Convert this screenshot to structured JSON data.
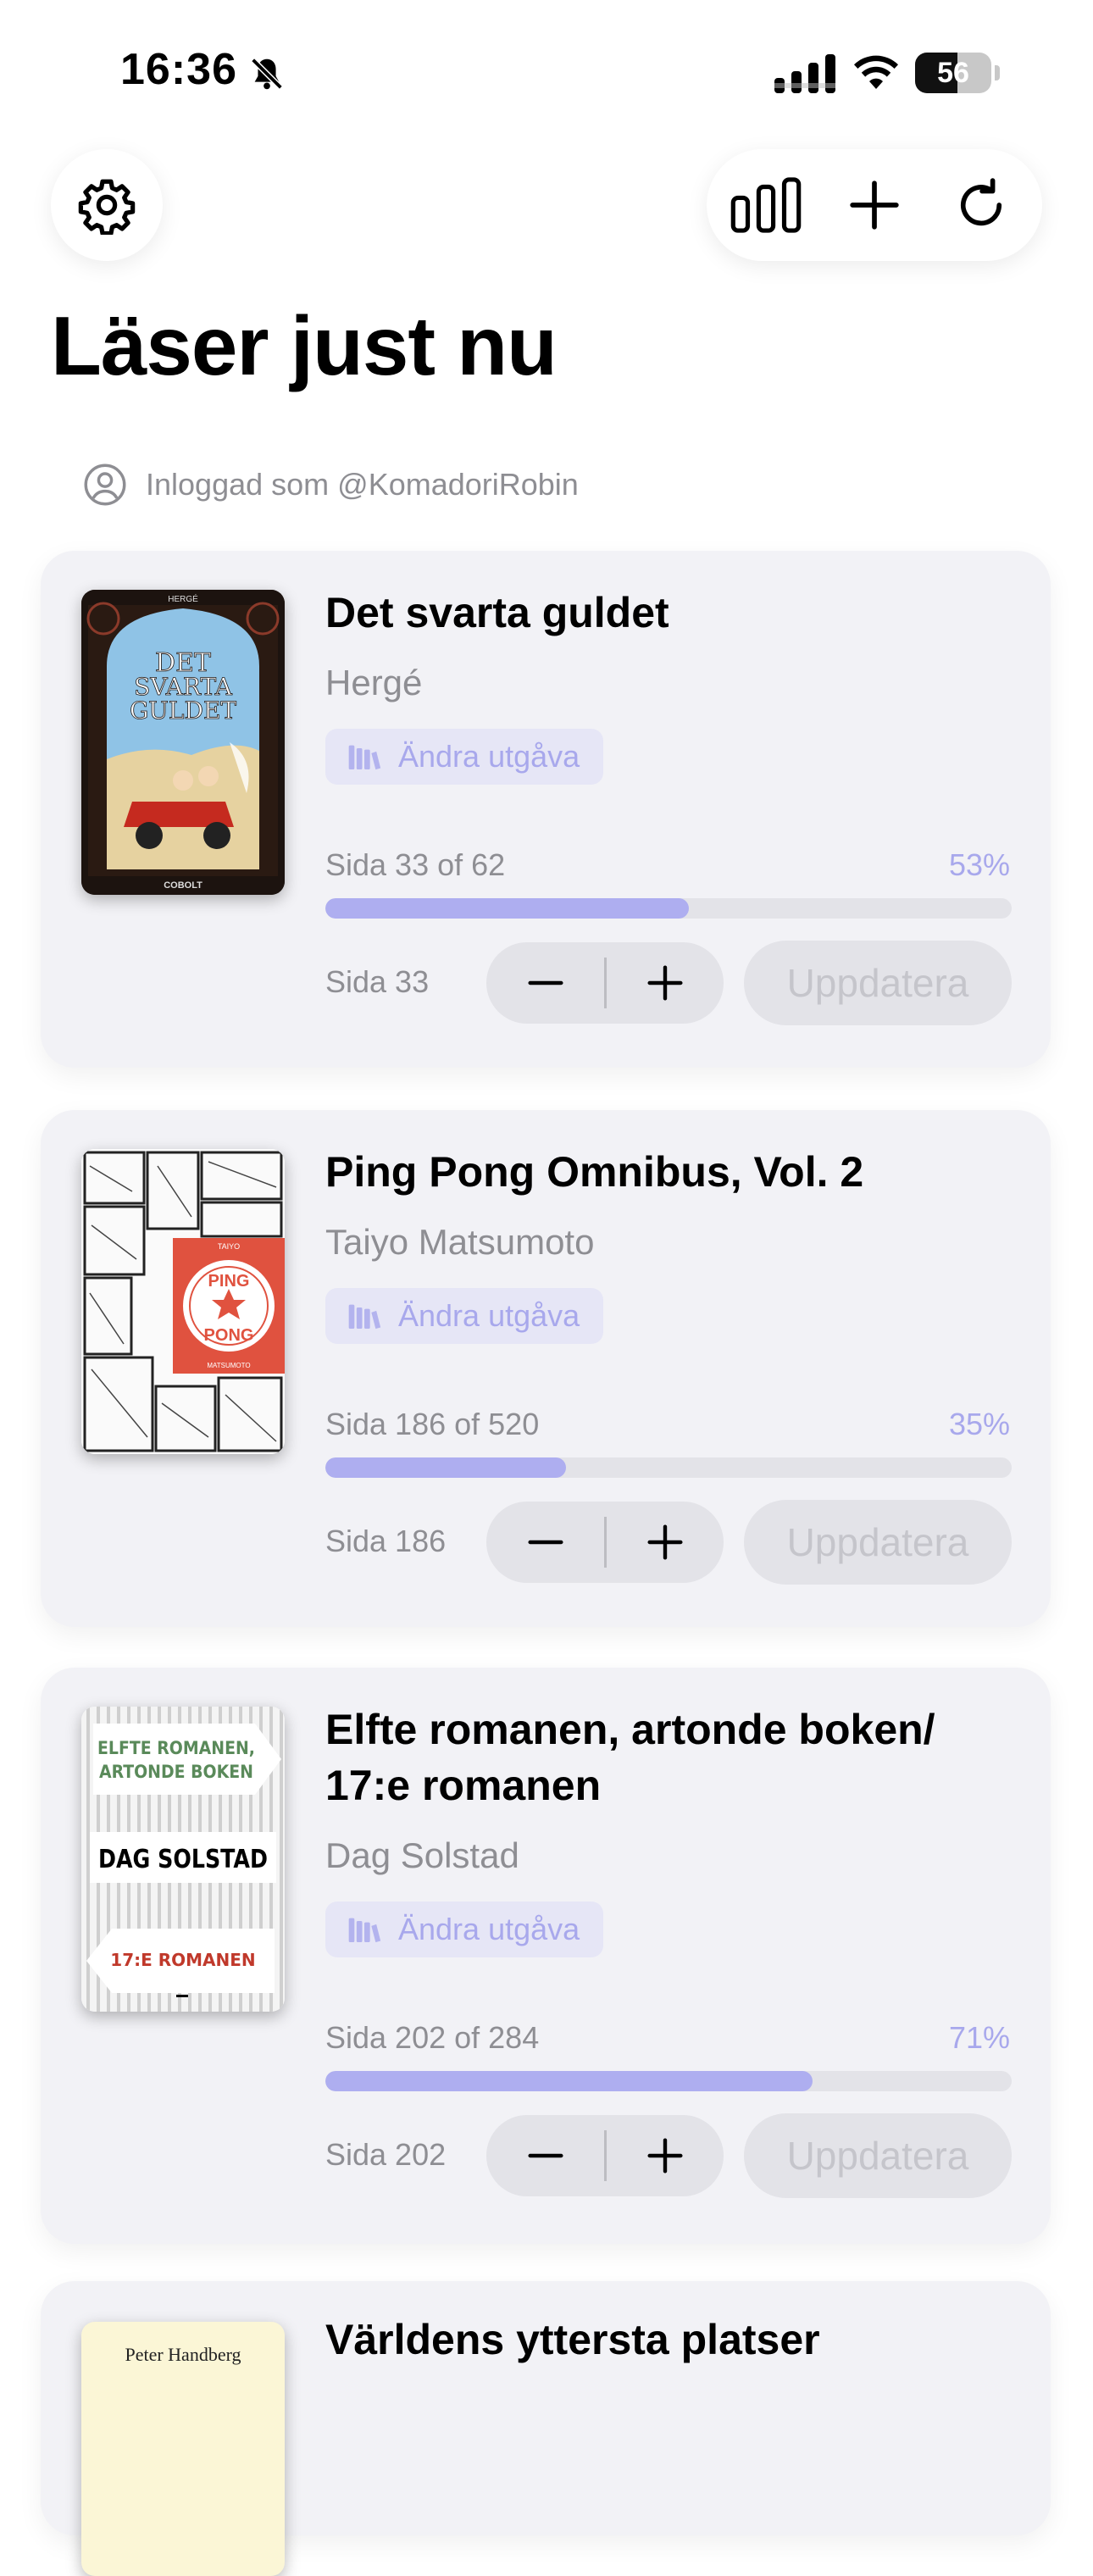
{
  "status_bar": {
    "time": "16:36",
    "battery": "56",
    "battery_level": 0.56
  },
  "header": {
    "title": "Läser just nu"
  },
  "account": {
    "text": "Inloggad som @KomadoriRobin"
  },
  "icons": {
    "settings": "gear-icon",
    "stats": "bar-chart-icon",
    "add": "plus-icon",
    "refresh": "refresh-icon",
    "mute": "bell-slash-icon",
    "profile": "person-circle-icon",
    "edition": "books-icon"
  },
  "colors": {
    "accent": "#aeaef0",
    "accent_text": "#a8a8ec",
    "card_bg": "#f2f2f6"
  },
  "books": [
    {
      "title": "Det svarta guldet",
      "author": "Hergé",
      "edition_label": "Ändra utgåva",
      "progress_label": "Sida 33 of 62",
      "percent_label": "53%",
      "progress": 0.53,
      "page_label": "Sida 33",
      "update_label": "Uppdatera",
      "cover": {
        "top_text": "HERGÉ",
        "title": "DET SVARTA GULDET",
        "bottom_text": "COBOLT"
      }
    },
    {
      "title": "Ping Pong Omnibus, Vol. 2",
      "author": "Taiyo Matsumoto",
      "edition_label": "Ändra utgåva",
      "progress_label": "Sida 186 of 520",
      "percent_label": "35%",
      "progress": 0.35,
      "page_label": "Sida 186",
      "update_label": "Uppdatera",
      "cover": {
        "top_text": "TAIYO",
        "title_1": "PING",
        "title_2": "PONG",
        "bottom_text": "MATSUMOTO"
      }
    },
    {
      "title": "Elfte romanen, artonde boken/ 17:e romanen",
      "author": "Dag Solstad",
      "edition_label": "Ändra utgåva",
      "progress_label": "Sida 202 of 284",
      "percent_label": "71%",
      "progress": 0.71,
      "page_label": "Sida 202",
      "update_label": "Uppdatera",
      "cover": {
        "line1": "ELFTE ROMANEN,",
        "line2": "ARTONDE BOKEN",
        "author": "DAG SOLSTAD",
        "line3": "17:E ROMANEN"
      }
    },
    {
      "title": "Världens yttersta platser",
      "cover": {
        "author": "Peter Handberg"
      }
    }
  ]
}
